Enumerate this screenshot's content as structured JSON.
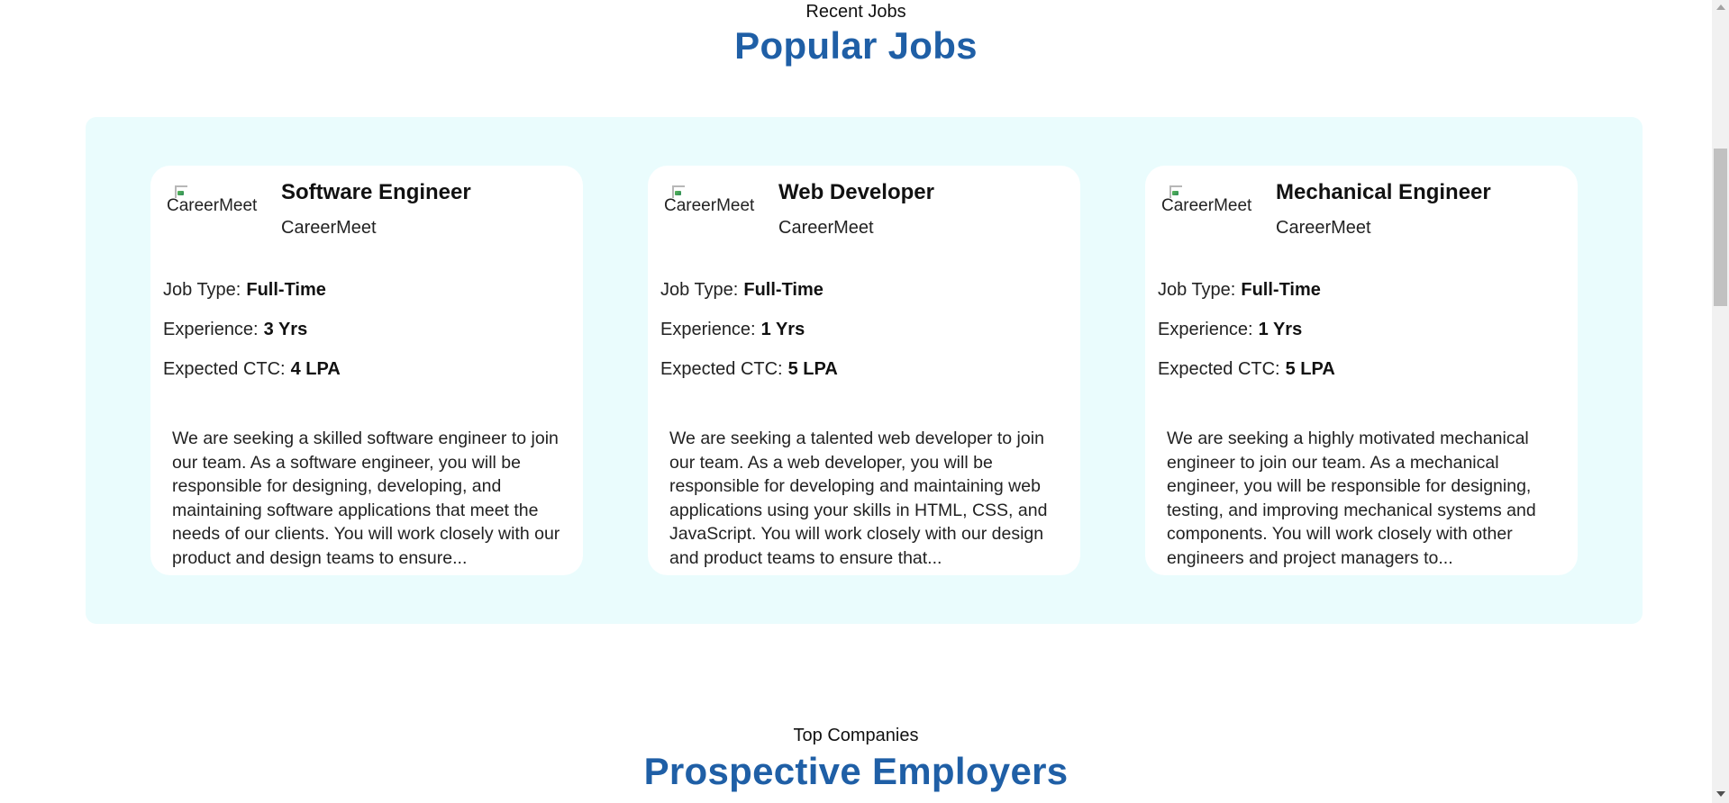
{
  "recent_section": {
    "eyebrow": "Recent Jobs",
    "title": "Popular Jobs"
  },
  "jobs": [
    {
      "logo_alt": "CareerMeet",
      "title": "Software Engineer",
      "company": "CareerMeet",
      "job_type_label": "Job Type:",
      "job_type": "Full-Time",
      "experience_label": "Experience:",
      "experience": "3 Yrs",
      "ctc_label": "Expected CTC:",
      "ctc": "4 LPA",
      "description": "We are seeking a skilled software engineer to join our team. As a software engineer, you will be responsible for designing, developing, and maintaining software applications that meet the needs of our clients. You will work closely with our product and design teams to ensure..."
    },
    {
      "logo_alt": "CareerMeet",
      "title": "Web Developer",
      "company": "CareerMeet",
      "job_type_label": "Job Type:",
      "job_type": "Full-Time",
      "experience_label": "Experience:",
      "experience": "1 Yrs",
      "ctc_label": "Expected CTC:",
      "ctc": "5 LPA",
      "description": "We are seeking a talented web developer to join our team. As a web developer, you will be responsible for developing and maintaining web applications using your skills in HTML, CSS, and JavaScript. You will work closely with our design and product teams to ensure that..."
    },
    {
      "logo_alt": "CareerMeet",
      "title": "Mechanical Engineer",
      "company": "CareerMeet",
      "job_type_label": "Job Type:",
      "job_type": "Full-Time",
      "experience_label": "Experience:",
      "experience": "1 Yrs",
      "ctc_label": "Expected CTC:",
      "ctc": "5 LPA",
      "description": "We are seeking a highly motivated mechanical engineer to join our team. As a mechanical engineer, you will be responsible for designing, testing, and improving mechanical systems and components. You will work closely with other engineers and project managers to..."
    }
  ],
  "companies_section": {
    "eyebrow": "Top Companies",
    "title": "Prospective Employers"
  },
  "colors": {
    "heading_blue": "#1f5fa6",
    "panel_background": "#eafcfd",
    "card_background": "#ffffff"
  },
  "icons": {
    "logo": "broken-image-icon",
    "scroll_up": "triangle-up-icon",
    "scroll_down": "triangle-down-icon"
  }
}
